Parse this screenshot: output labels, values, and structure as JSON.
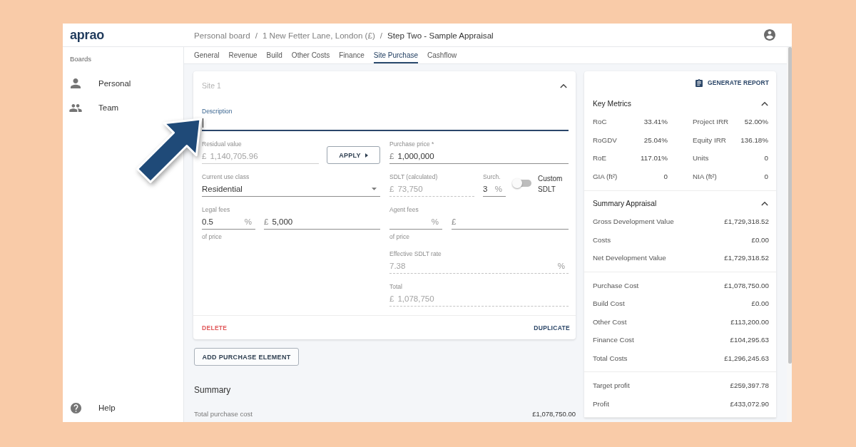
{
  "annotation": {
    "kind": "arrow"
  },
  "header": {
    "logo": "aprao",
    "breadcrumb": [
      {
        "label": "Personal board",
        "current": false
      },
      {
        "label": "1 New Fetter Lane, London (£)",
        "current": false
      },
      {
        "label": "Step Two - Sample Appraisal",
        "current": true
      }
    ],
    "separators": [
      "/",
      "/"
    ]
  },
  "sidebar": {
    "heading": "Boards",
    "items": [
      {
        "label": "Personal",
        "selected": false
      },
      {
        "label": "Team",
        "selected": false
      }
    ],
    "help": "Help"
  },
  "tabs": [
    {
      "label": "General",
      "selected": false
    },
    {
      "label": "Revenue",
      "selected": false
    },
    {
      "label": "Build",
      "selected": false
    },
    {
      "label": "Other Costs",
      "selected": false
    },
    {
      "label": "Finance",
      "selected": false
    },
    {
      "label": "Site Purchase",
      "selected": true
    },
    {
      "label": "Cashflow",
      "selected": false
    }
  ],
  "site": {
    "title": "Site 1",
    "expanded": true,
    "description": {
      "label": "Description",
      "focused": true
    },
    "residual_value": {
      "label": "Residual value",
      "prefix": "£",
      "value": "1,140,705.96",
      "kind": "readonly"
    },
    "apply_button": "APPLY",
    "purchase_price": {
      "label": "Purchase price *",
      "prefix": "£",
      "value": "1,000,000",
      "kind": "input"
    },
    "current_use_class": {
      "label": "Current use class",
      "value": "Residential",
      "kind": "select"
    },
    "sdlt": {
      "label": "SDLT (calculated)",
      "prefix": "£",
      "value": "73,750",
      "kind": "calculated"
    },
    "surcharge": {
      "label": "Surch.",
      "value": "3",
      "suffix": "%",
      "kind": "input"
    },
    "custom_sdlt": {
      "label": "Custom SDLT",
      "on": false
    },
    "legal_fees": {
      "label": "Legal fees",
      "percent": {
        "value": "0.5",
        "suffix": "%",
        "kind": "input"
      },
      "amount": {
        "prefix": "£",
        "value": "5,000",
        "kind": "input"
      },
      "hint": "of price"
    },
    "agent_fees": {
      "label": "Agent fees",
      "percent": {
        "suffix": "%",
        "kind": "input"
      },
      "amount": {
        "prefix": "£",
        "kind": "input"
      },
      "hint": "of price"
    },
    "effective_sdlt_rate": {
      "label": "Effective SDLT rate",
      "value": "7.38",
      "suffix": "%",
      "kind": "calculated"
    },
    "total": {
      "label": "Total",
      "prefix": "£",
      "value": "1,078,750",
      "kind": "calculated"
    },
    "actions": [
      {
        "label": "DELETE",
        "kind": "danger"
      },
      {
        "label": "DUPLICATE",
        "kind": "primary"
      }
    ]
  },
  "add_button": "ADD PURCHASE ELEMENT",
  "summary": {
    "title": "Summary",
    "rows": [
      {
        "label": "Total purchase cost",
        "value": "£1,078,750.00"
      }
    ]
  },
  "side_panel": {
    "report_button": "GENERATE REPORT",
    "key_metrics": {
      "title": "Key Metrics",
      "expanded": true,
      "items": [
        {
          "label": "RoC",
          "value": "33.41%"
        },
        {
          "label": "Project IRR",
          "value": "52.00%"
        },
        {
          "label": "RoGDV",
          "value": "25.04%"
        },
        {
          "label": "Equity IRR",
          "value": "136.18%"
        },
        {
          "label": "RoE",
          "value": "117.01%"
        },
        {
          "label": "Units",
          "value": "0"
        },
        {
          "label": "GIA (ft²)",
          "value": "0"
        },
        {
          "label": "NIA (ft²)",
          "value": "0"
        }
      ]
    },
    "summary_appraisal": {
      "title": "Summary Appraisal",
      "expanded": true,
      "groups": [
        {
          "rows": [
            {
              "label": "Gross Development Value",
              "value": "£1,729,318.52"
            },
            {
              "label": "Costs",
              "value": "£0.00"
            },
            {
              "label": "Net Development Value",
              "value": "£1,729,318.52"
            }
          ]
        },
        {
          "rows": [
            {
              "label": "Purchase Cost",
              "value": "£1,078,750.00"
            },
            {
              "label": "Build Cost",
              "value": "£0.00"
            },
            {
              "label": "Other Cost",
              "value": "£113,200.00"
            },
            {
              "label": "Finance Cost",
              "value": "£104,295.63"
            },
            {
              "label": "Total Costs",
              "value": "£1,296,245.63"
            }
          ]
        },
        {
          "rows": [
            {
              "label": "Target profit",
              "value": "£259,397.78"
            },
            {
              "label": "Profit",
              "value": "£433,072.90"
            }
          ]
        }
      ]
    }
  }
}
